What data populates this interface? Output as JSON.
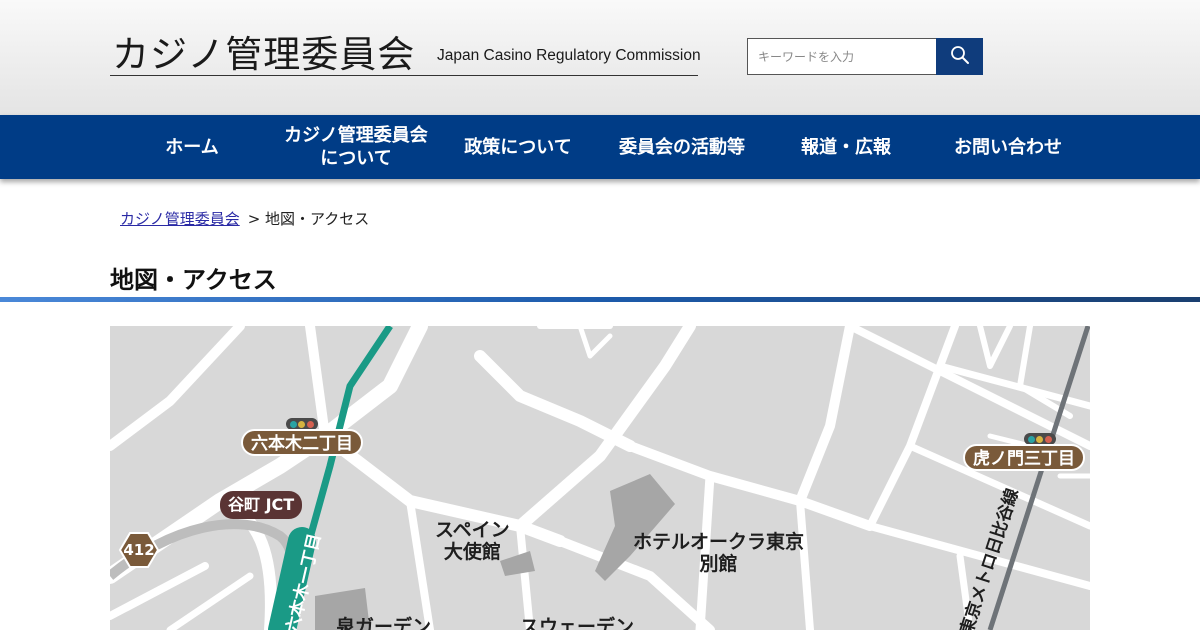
{
  "header": {
    "logo_jp": "カジノ管理委員会",
    "logo_en": "Japan Casino Regulatory Commission",
    "search_placeholder": "キーワードを入力",
    "search_icon": "search-icon"
  },
  "nav": {
    "items": [
      {
        "label": "ホーム"
      },
      {
        "label": "カジノ管理委員会\nについて"
      },
      {
        "label": "政策について"
      },
      {
        "label": "委員会の活動等"
      },
      {
        "label": "報道・広報"
      },
      {
        "label": "お問い合わせ"
      }
    ]
  },
  "breadcrumb": {
    "home": "カジノ管理委員会",
    "current": "> 地図・アクセス"
  },
  "page": {
    "title": "地図・アクセス"
  },
  "map": {
    "labels": {
      "spain_embassy": "スペイン\n大使館",
      "hotel_okura": "ホテルオークラ東京\n別館",
      "izumi_garden": "泉ガーデン",
      "sweden": "スウェーデン"
    },
    "stations": {
      "roppongi_2": "六本木二丁目",
      "toranomon_3": "虎ノ門三丁目"
    },
    "junction": "谷町 JCT",
    "route_number": "412",
    "line_labels": {
      "roppongi_1": "六本木一丁目",
      "hibiya_line": "東京メトロ日比谷線"
    },
    "colors": {
      "background": "#d8d8d8",
      "road": "#ffffff",
      "green_line": "#1a9a86",
      "hibiya_line": "#6e7378",
      "station_badge": "#7a5a3a",
      "junction_badge": "#5a3434"
    }
  }
}
